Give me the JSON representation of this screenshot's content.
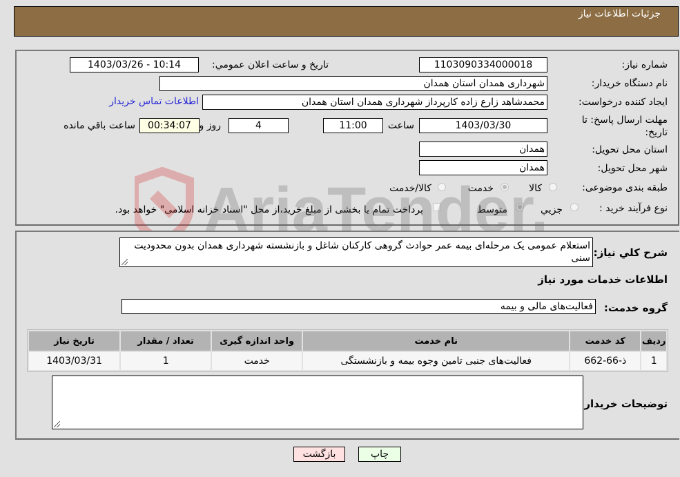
{
  "header": {
    "title": "جزئيات اطلاعات نياز"
  },
  "fields": {
    "need_number": {
      "label": "شماره نياز:",
      "value": "1103090334000018"
    },
    "announce_datetime": {
      "label": "تاريخ و ساعت اعلان عمومي:",
      "value": "1403/03/26 - 10:14"
    },
    "buyer_org": {
      "label": "نام دستگاه خريدار:",
      "value": "شهرداری همدان استان همدان"
    },
    "requester": {
      "label": "ايجاد کننده درخواست:",
      "value": "محمدشاهد زارع زاده کارپرداز شهرداری همدان استان همدان",
      "contact_link": "اطلاعات تماس خريدار"
    },
    "deadline": {
      "label": "مهلت ارسال پاسخ: تا تاريخ:",
      "date": "1403/03/30",
      "time_label": "ساعت",
      "time": "11:00",
      "days": "4",
      "days_label": "روز و",
      "remaining": "00:34:07",
      "remaining_label": "ساعت باقي مانده"
    },
    "province": {
      "label": "استان محل تحويل:",
      "value": "همدان"
    },
    "city": {
      "label": "شهر محل تحويل:",
      "value": "همدان"
    },
    "category": {
      "label": "طبقه بندی موضوعی:",
      "options": [
        {
          "label": "کالا",
          "checked": false
        },
        {
          "label": "خدمت",
          "checked": true
        },
        {
          "label": "کالا/خدمت",
          "checked": false
        }
      ]
    },
    "purchase_type": {
      "label": "نوع فرآيند خريد :",
      "options": [
        {
          "label": "جزيي",
          "checked": false
        },
        {
          "label": "متوسط",
          "checked": true
        }
      ],
      "treasury_note": "پرداخت تمام يا بخشی از مبلغ خريد،از محل \"اسناد خزانه اسلامی\" خواهد بود."
    }
  },
  "description": {
    "label": "شرح کلي نياز:",
    "value": "استعلام عمومی یک مرحله‌ای بیمه عمر حوادث گروهی کارکنان شاغل و بازنشسته شهرداری همدان بدون محدودیت سنی"
  },
  "services": {
    "section_title": "اطلاعات خدمات مورد نياز",
    "group_label": "گروه خدمت:",
    "group_value": "فعاليت‌های مالی و بيمه",
    "columns": [
      "رديف",
      "کد خدمت",
      "نام خدمت",
      "واحد اندازه گيری",
      "تعداد / مقدار",
      "تاريخ نياز"
    ],
    "rows": [
      [
        "1",
        "ذ-66-662",
        "فعاليت‌های جنبی تامين وجوه بيمه و بازنشستگی",
        "خدمت",
        "1",
        "1403/03/31"
      ]
    ]
  },
  "buyer_notes": {
    "label": "توضيحات خريدار:",
    "value": ""
  },
  "buttons": {
    "print": "چاپ",
    "back": "بازگشت"
  },
  "watermark": {
    "text": "AriaTender.neT"
  },
  "colors": {
    "header_bg": "#8d6e44",
    "print_bg": "#ebffe6",
    "back_bg": "#ffe1e1",
    "link": "#2626d6"
  }
}
